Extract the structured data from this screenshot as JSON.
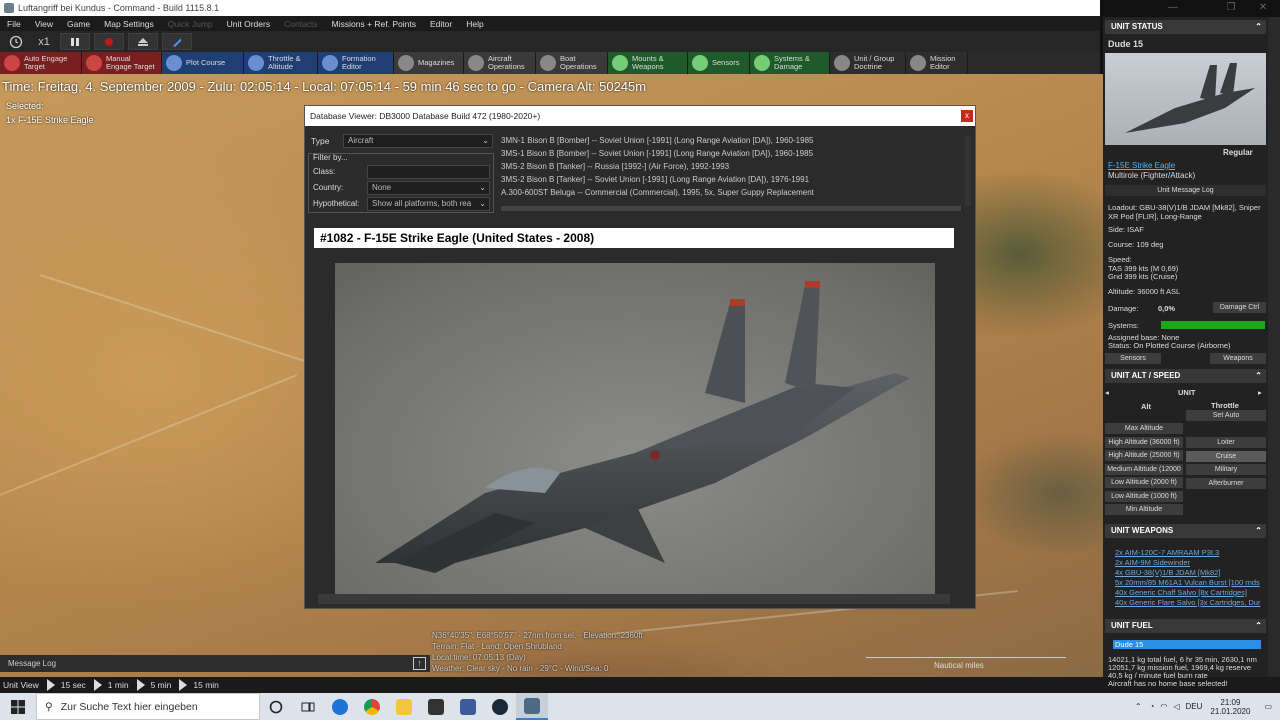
{
  "window": {
    "title": "Luftangriff bei Kundus - Command - Build 1115.8.1",
    "controls": [
      "—",
      "❐",
      "✕"
    ]
  },
  "menu": [
    "File",
    "View",
    "Game",
    "Map Settings",
    "Quick Jump",
    "Unit Orders",
    "Contacts",
    "Missions + Ref. Points",
    "Editor",
    "Help"
  ],
  "toolbar1": {
    "speed": "x1"
  },
  "toolbar2": [
    {
      "label": "Auto Engage Target",
      "name": "auto-engage-target-button",
      "style": "red",
      "icon": "#c44"
    },
    {
      "label": "Manual Engage Target",
      "name": "manual-engage-target-button",
      "style": "red",
      "icon": "#c44"
    },
    {
      "label": "Plot Course",
      "name": "plot-course-button",
      "style": "blue",
      "icon": "#6a8fd0"
    },
    {
      "label": "Throttle & Altitude",
      "name": "throttle-altitude-button",
      "style": "blue",
      "icon": "#6a8fd0"
    },
    {
      "label": "Formation Editor",
      "name": "formation-editor-button",
      "style": "blue",
      "icon": "#6a8fd0"
    },
    {
      "label": "Magazines",
      "name": "magazines-button",
      "style": "gray",
      "icon": "#888"
    },
    {
      "label": "Aircraft Operations",
      "name": "aircraft-operations-button",
      "style": "gray",
      "icon": "#888"
    },
    {
      "label": "Boat Operations",
      "name": "boat-operations-button",
      "style": "gray",
      "icon": "#888"
    },
    {
      "label": "Mounts & Weapons",
      "name": "mounts-weapons-button",
      "style": "green",
      "icon": "#7c7"
    },
    {
      "label": "Sensors",
      "name": "sensors-button",
      "style": "green",
      "icon": "#7c7"
    },
    {
      "label": "Systems & Damage",
      "name": "systems-damage-button",
      "style": "green",
      "icon": "#7c7"
    },
    {
      "label": "Unit / Group Doctrine",
      "name": "unit-group-doctrine-button",
      "style": "dark",
      "icon": "#888"
    },
    {
      "label": "Mission Editor",
      "name": "mission-editor-button",
      "style": "dark",
      "icon": "#888"
    }
  ],
  "timeline": "Time: Freitag, 4. September 2009 - Zulu: 02:05:14 - Local: 07:05:14 - 59 min 46 sec to go -  Camera Alt: 50245m",
  "selected": {
    "label": "Selected:",
    "unit": "1x F-15E Strike Eagle"
  },
  "dbviewer": {
    "title": "Database Viewer: DB3000 Database Build 472 (1980-2020+)",
    "close": "x",
    "type_label": "Type",
    "type_value": "Aircraft",
    "filter_label": "Filter by...",
    "class_label": "Class:",
    "country_label": "Country:",
    "country_value": "None",
    "hypothetical_label": "Hypothetical:",
    "hypothetical_value": "Show all platforms, both rea",
    "list": [
      "3MN-1 Bison B [Bomber] -- Soviet Union [-1991] (Long Range Aviation [DA]), 1960-1985",
      "3MS-1 Bison B [Bomber] -- Soviet Union [-1991] (Long Range Aviation [DA]), 1960-1985",
      "3MS-2 Bison B [Tanker] -- Russia [1992-] (Air Force), 1992-1993",
      "3MS-2 Bison B [Tanker] -- Soviet Union [-1991] (Long Range Aviation [DA]), 1976-1991",
      "A.300-600ST Beluga -- Commercial (Commercial), 1995, 5x, Super Guppy Replacement"
    ],
    "header": "#1082 - F-15E Strike Eagle (United States - 2008)"
  },
  "bottom": {
    "message_log": "Message Log",
    "coords": [
      "N36°40'35\", E68°50'57\" - 27nm from sel. - Elevation: 2360ft",
      "Terrain: Flat - Land: Open Shrubland",
      "Local time: 07:05:13 (Day)",
      "Weather: Clear sky - No rain - 29°C - Wind/Sea: 0"
    ],
    "scale_label": "Nautical miles",
    "unit_view": "Unit View",
    "time_steps": [
      "15 sec",
      "1 min",
      "5 min",
      "15 min"
    ]
  },
  "taskbar": {
    "search_placeholder": "Zur Suche Text hier eingeben",
    "lang": "DEU",
    "time": "21:09",
    "date": "21.01.2020"
  },
  "panel": {
    "status_title": "UNIT STATUS",
    "unit_name": "Dude 15",
    "proficiency": "Regular",
    "aircraft": "F-15E Strike Eagle",
    "role": "Multirole (Fighter/Attack)",
    "msg_log_btn": "Unit Message Log",
    "loadout": "Loadout: GBU-38(V)1/B JDAM [Mk82], Sniper XR Pod [FLIR], Long-Range",
    "side": "Side: ISAF",
    "course": "Course: 109 deg",
    "speed_label": "Speed:",
    "tas": "TAS 399 kts (M 0,69)",
    "gnd": "Gnd 399 kts (Cruise)",
    "altitude": "Altitude: 36000 ft ASL",
    "damage_label": "Damage:",
    "damage_value": "0,0%",
    "damage_btn": "Damage Ctrl",
    "systems_label": "Systems:",
    "systems_fill": 1.0,
    "base": "Assigned base: None",
    "status": "Status: On Plotted Course (Airborne)",
    "sensors_btn": "Sensors",
    "weapons_btn": "Weapons",
    "alt_title": "UNIT ALT / SPEED",
    "unit_label": "UNIT",
    "alt_col": "Alt",
    "throttle_col": "Throttle",
    "set_auto": "Set Auto",
    "alt_options": [
      "Max Altitude",
      "High Altitude (36000 ft)",
      "High Altitude (25000 ft)",
      "Medium Altitude (12000",
      "Low Altitude (2000 ft)",
      "Low Altitude (1000 ft)",
      "Min Altitude"
    ],
    "throttle_options": [
      "Loiter",
      "Cruise",
      "Military",
      "Afterburner"
    ],
    "weapons_title": "UNIT WEAPONS",
    "weapons": [
      "2x AIM-120C-7 AMRAAM P3I.3",
      "2x AIM-9M Sidewinder",
      "4x GBU-38(V)1/B JDAM [Mk82]",
      "5x 20mm/85 M61A1 Vulcan Burst [100 rnds",
      "40x Generic Chaff Salvo [8x Cartridges]",
      "40x Generic Flare Salvo [3x Cartridges, Dur"
    ],
    "fuel_title": "UNIT FUEL",
    "fuel_unit": "Dude 15",
    "fuel_lines": [
      "14021,1 kg total fuel, 6 hr 35 min, 2630,1 nm",
      "12051,7 kg mission fuel, 1969,4 kg reserve",
      "40,5 kg / minute fuel burn rate",
      "Aircraft has no home base selected!"
    ]
  },
  "colors": {
    "systems_bar": "#1fa61f",
    "link": "#6fa8dc",
    "fuel_highlight": "#2b8fe6"
  }
}
